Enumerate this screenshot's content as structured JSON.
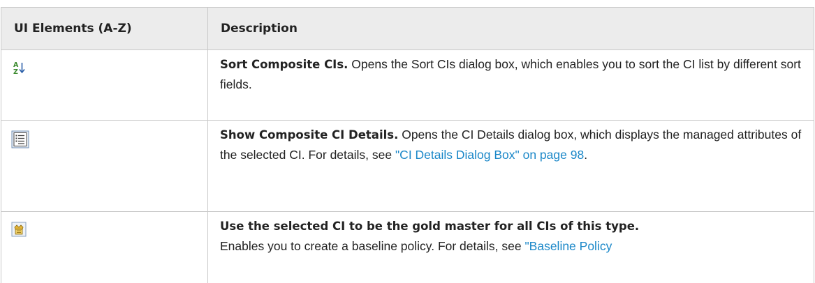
{
  "header": {
    "col_elements": "UI Elements (A-Z)",
    "col_description": "Description"
  },
  "rows": [
    {
      "icon": "sort-az-icon",
      "title": "Sort Composite CIs.",
      "text": " Opens the Sort CIs dialog box, which enables you to sort the CI list by different sort fields."
    },
    {
      "icon": "details-window-icon",
      "title": "Show Composite CI Details.",
      "text": " Opens the CI Details dialog box, which displays the managed attributes of the selected CI. For details, see ",
      "link": "\"CI Details Dialog Box\" on page 98",
      "text_after": "."
    },
    {
      "icon": "gold-master-icon",
      "title": "Use the selected CI to be the gold master for all CIs of this type.",
      "text": "Enables you to create a baseline policy. For details, see ",
      "link": "\"Baseline Policy"
    }
  ],
  "colors": {
    "header_bg": "#ececec",
    "border": "#c9c9c9",
    "link": "#1a87c8"
  }
}
